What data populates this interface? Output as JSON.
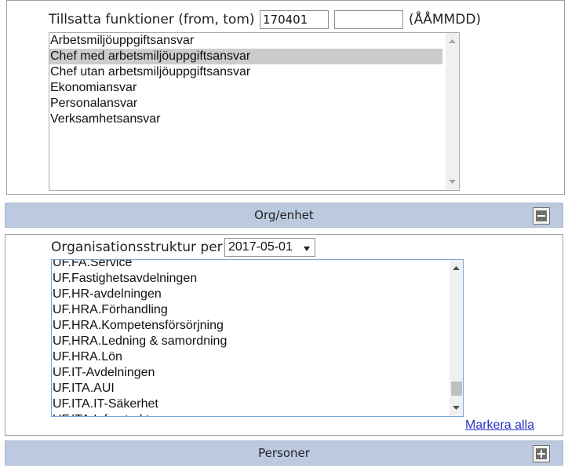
{
  "functions": {
    "label": "Tillsatta funktioner (from, tom)",
    "from_value": "170401",
    "to_value": "",
    "format_hint": "(ÅÅMMDD)",
    "items": [
      {
        "label": "Arbetsmiljöuppgiftsansvar",
        "selected": false
      },
      {
        "label": "Chef med arbetsmiljöuppgiftsansvar",
        "selected": true
      },
      {
        "label": "Chef utan arbetsmiljöuppgiftsansvar",
        "selected": false
      },
      {
        "label": "Ekonomiansvar",
        "selected": false
      },
      {
        "label": "Personalansvar",
        "selected": false
      },
      {
        "label": "Verksamhetsansvar",
        "selected": false
      }
    ]
  },
  "org_section": {
    "title": "Org/enhet",
    "toggle_icon": "collapse-minus-icon",
    "label": "Organisationsstruktur per",
    "date_value": "2017-05-01",
    "items": [
      "UF.FA.Service",
      "UF.Fastighetsavdelningen",
      "UF.HR-avdelningen",
      "UF.HRA.Förhandling",
      "UF.HRA.Kompetensförsörjning",
      "UF.HRA.Ledning & samordning",
      "UF.HRA.Lön",
      "UF.IT-Avdelningen",
      "UF.ITA.AUI",
      "UF.ITA.IT-Säkerhet",
      "UF.ITA.Infrastruktur"
    ],
    "select_all_link": "Markera alla"
  },
  "persons_section": {
    "title": "Personer",
    "toggle_icon": "expand-plus-icon"
  },
  "colors": {
    "section_bar": "#bccae0",
    "selected_item": "#cccccc",
    "link": "#2a32c8",
    "focus_border": "#7aa7d8"
  }
}
